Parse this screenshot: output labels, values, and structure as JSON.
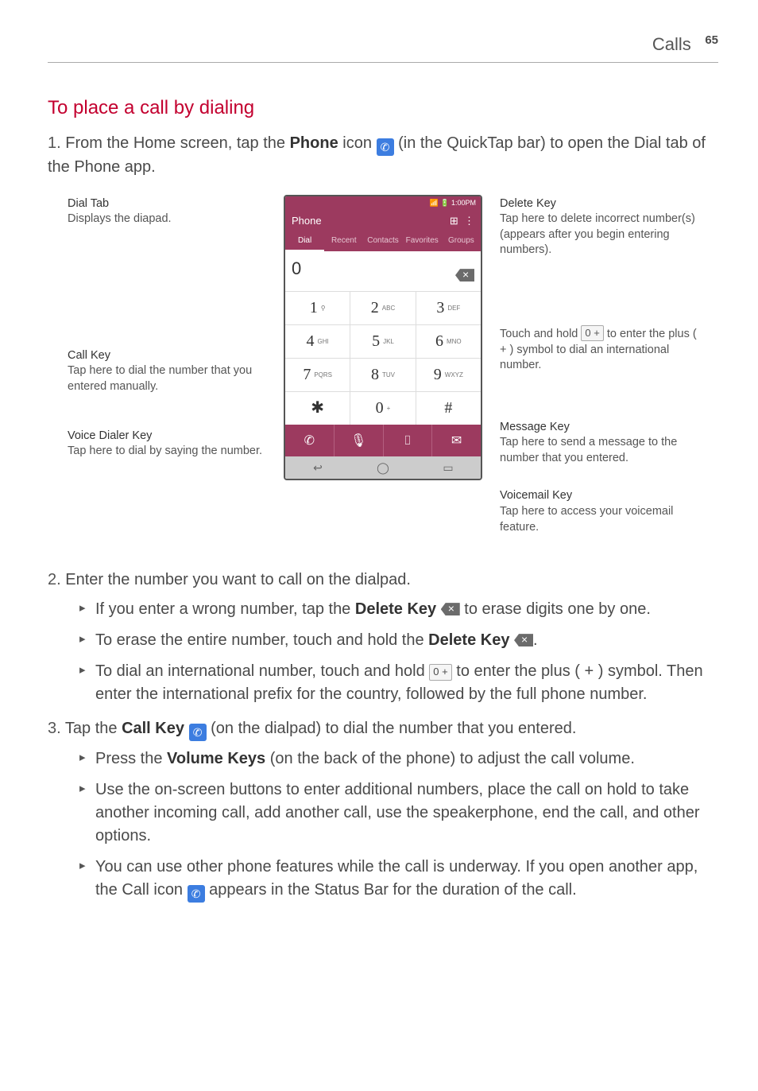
{
  "header": {
    "section": "Calls",
    "page": "65"
  },
  "h2": "To place a call by dialing",
  "step1": {
    "num": "1.",
    "p1a": "From the Home screen, tap the ",
    "bold1": "Phone",
    "p1b": " icon ",
    "p1c": " (in the QuickTap bar) to open the Dial tab of the Phone app."
  },
  "figure": {
    "status_time": "1:00PM",
    "app_title": "Phone",
    "tabs": [
      "Dial",
      "Recent",
      "Contacts",
      "Favorites",
      "Groups"
    ],
    "display_zero": "0",
    "keys": [
      [
        "1",
        ""
      ],
      [
        "2",
        "ABC"
      ],
      [
        "3",
        "DEF"
      ],
      [
        "4",
        "GHI"
      ],
      [
        "5",
        "JKL"
      ],
      [
        "6",
        "MNO"
      ],
      [
        "7",
        "PQRS"
      ],
      [
        "8",
        "TUV"
      ],
      [
        "9",
        "WXYZ"
      ],
      [
        "✱",
        ""
      ],
      [
        "0",
        "+"
      ],
      [
        "#",
        ""
      ]
    ],
    "left_callouts": {
      "dial_tab_t": "Dial Tab",
      "dial_tab_d": "Displays the diapad.",
      "call_key_t": "Call Key",
      "call_key_d": "Tap here to dial the number that you entered manually.",
      "voice_key_t": "Voice Dialer Key",
      "voice_key_d": "Tap here to dial by saying the number."
    },
    "right_callouts": {
      "delete_t": "Delete Key",
      "delete_d": "Tap here to delete incorrect number(s) (appears after you begin entering numbers).",
      "hold_d1": "Touch and hold ",
      "hold_d2": " to enter the plus ( + ) symbol to dial an international number.",
      "msg_t": "Message Key",
      "msg_d": "Tap here to send a message to the number that you entered.",
      "vm_t": "Voicemail Key",
      "vm_d": "Tap here to access your voicemail feature."
    }
  },
  "step2": {
    "num": "2.",
    "text": "Enter the number you want to call on the dialpad.",
    "b1a": "If you enter a wrong number, tap the ",
    "b1bold": "Delete Key",
    "b1b": " to erase digits one by one.",
    "b2a": "To erase the entire number, touch and hold the ",
    "b2bold": "Delete Key",
    "b2b": ".",
    "b3a": "To dial an international number, touch and hold ",
    "b3b": " to enter the plus ( + ) symbol. Then enter the international prefix for the country, followed by the full phone number."
  },
  "step3": {
    "num": "3.",
    "p1a": "Tap the ",
    "bold1": "Call Key",
    "p1b": " (on the dialpad) to dial the number that you entered.",
    "b1a": "Press the ",
    "b1bold": "Volume Keys",
    "b1b": " (on the back of the phone) to adjust the call volume.",
    "b2": "Use the on-screen buttons to enter additional numbers, place the call on hold to take another incoming call, add another call, use the speakerphone, end the call, and other options.",
    "b3a": "You can use other phone features while the call is underway. If you open another app, the Call icon ",
    "b3b": " appears in the Status Bar for the duration of the call."
  },
  "zero_plus": "0 +"
}
